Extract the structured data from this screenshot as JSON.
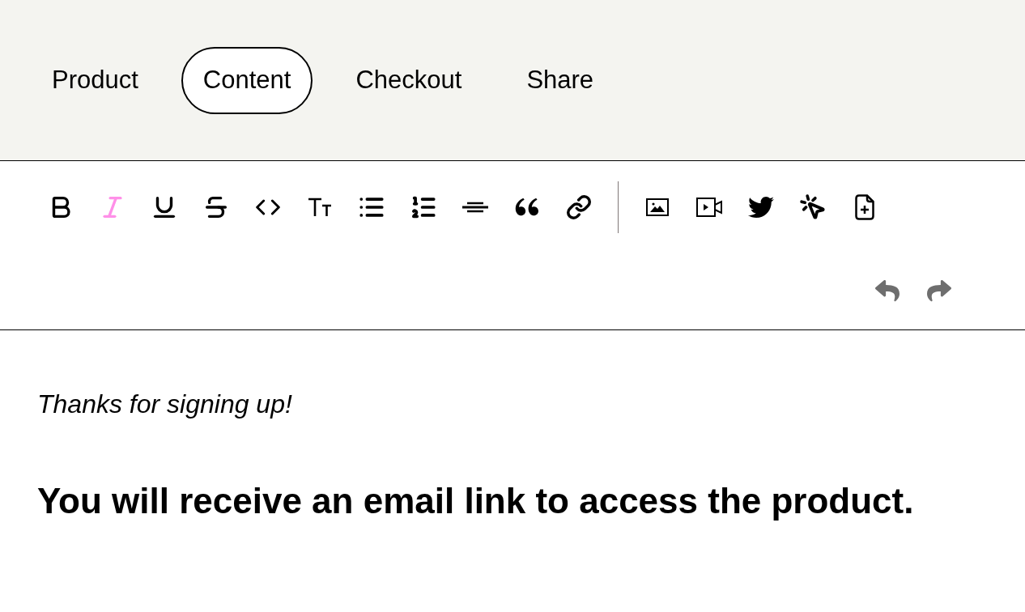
{
  "tabs": [
    {
      "label": "Product",
      "selected": false
    },
    {
      "label": "Content",
      "selected": true
    },
    {
      "label": "Checkout",
      "selected": false
    },
    {
      "label": "Share",
      "selected": false
    }
  ],
  "toolbar": {
    "format_buttons": [
      {
        "active": false
      },
      {
        "active": true
      },
      {
        "active": false
      },
      {
        "active": false
      },
      {
        "active": false
      },
      {
        "active": false
      },
      {
        "active": false
      },
      {
        "active": false
      },
      {
        "active": false
      },
      {
        "active": false
      },
      {
        "active": false
      }
    ]
  },
  "content": {
    "blocks": [
      {
        "kind": "italic",
        "text": "Thanks for signing up!"
      },
      {
        "kind": "heading",
        "text": "You will receive an email link to access the product."
      }
    ]
  }
}
